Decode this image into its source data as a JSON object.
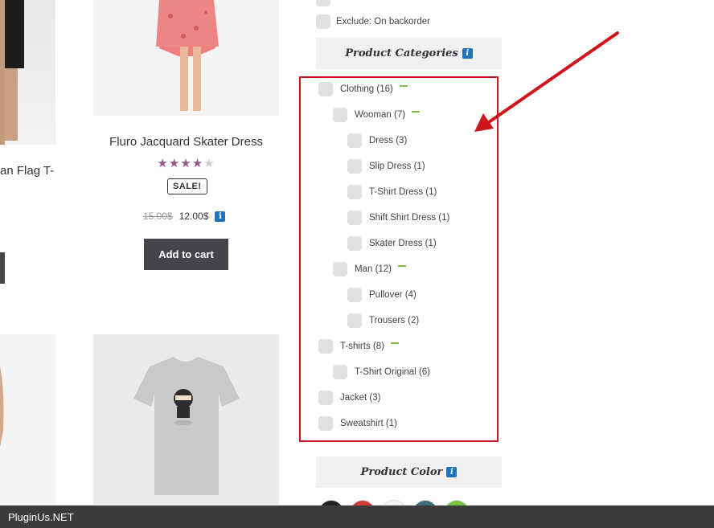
{
  "products": {
    "left_title_fragment": "an Flag T-",
    "dress": {
      "title": "Fluro Jacquard Skater Dress",
      "rating": 4,
      "rating_max": 5,
      "sale_label": "SALE!",
      "price_old": "15.00$",
      "price_new": "12.00$",
      "add_to_cart": "Add to cart"
    }
  },
  "filters": {
    "exclude_label": "Exclude: On backorder",
    "categories_title": "Product Categories",
    "color_title": "Product Color",
    "categories": [
      {
        "label": "Clothing (16)",
        "level": 0,
        "expanded": true
      },
      {
        "label": "Wooman (7)",
        "level": 1,
        "expanded": true
      },
      {
        "label": "Dress (3)",
        "level": 2,
        "expanded": false
      },
      {
        "label": "Slip Dress (1)",
        "level": 2,
        "expanded": false
      },
      {
        "label": "T-Shirt Dress (1)",
        "level": 2,
        "expanded": false
      },
      {
        "label": "Shift Shirt Dress (1)",
        "level": 2,
        "expanded": false
      },
      {
        "label": "Skater Dress (1)",
        "level": 2,
        "expanded": false
      },
      {
        "label": "Man (12)",
        "level": 1,
        "expanded": true
      },
      {
        "label": "Pullover (4)",
        "level": 2,
        "expanded": false
      },
      {
        "label": "Trousers (2)",
        "level": 2,
        "expanded": false
      },
      {
        "label": "T-shirts (8)",
        "level": 0,
        "expanded": true
      },
      {
        "label": "T-Shirt Original (6)",
        "level": 1,
        "expanded": false
      },
      {
        "label": "Jacket (3)",
        "level": 0,
        "expanded": false
      },
      {
        "label": "Sweatshirt (1)",
        "level": 0,
        "expanded": false
      }
    ],
    "colors": [
      "#222222",
      "#d33a3a",
      "#f4f4f4",
      "#3c6e7c",
      "#7ac142"
    ]
  },
  "footer": {
    "brand": "PluginUs.NET"
  },
  "theme": {
    "accent": "#96588a",
    "button": "#43454b",
    "highlight": "#d0141c",
    "info": "#1e73be"
  }
}
